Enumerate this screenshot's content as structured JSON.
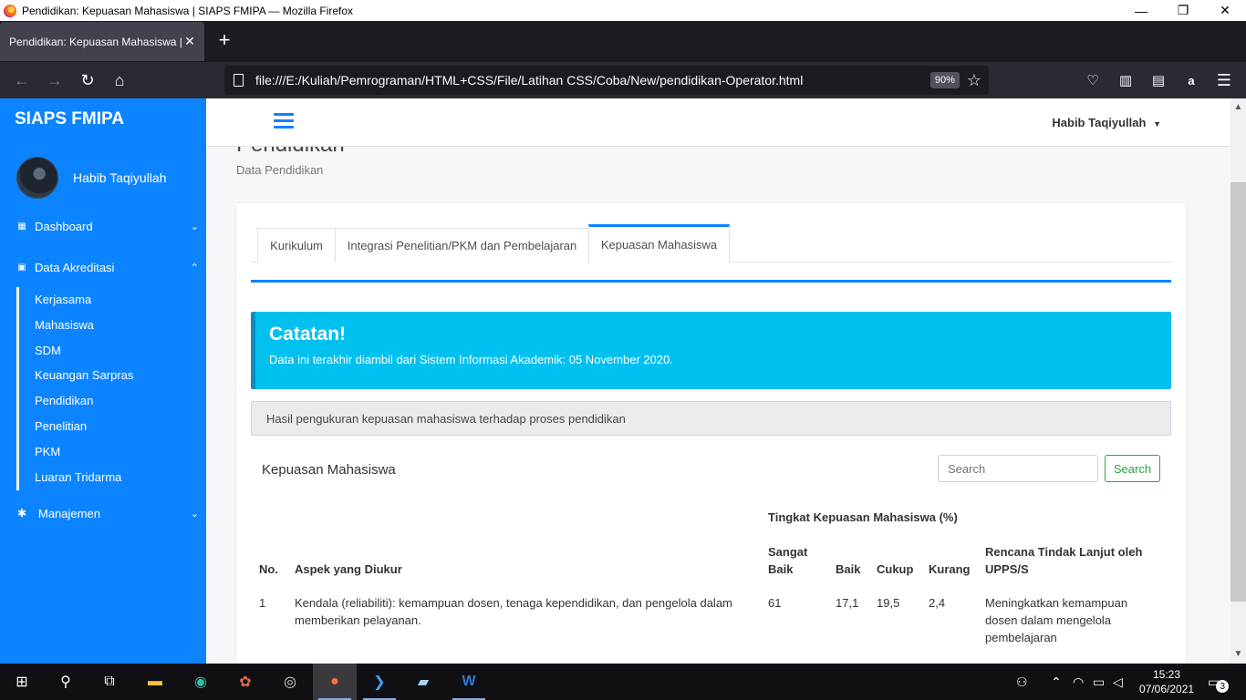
{
  "window": {
    "title": "Pendidikan: Kepuasan Mahasiswa | SIAPS FMIPA — Mozilla Firefox",
    "minimize": "—",
    "restore": "❐",
    "close": "✕"
  },
  "browser": {
    "tab_title": "Pendidikan: Kepuasan Mahasiswa | SIAPS FMIPA",
    "tab_close": "✕",
    "new_tab": "+",
    "url": "file:///E:/Kuliah/Pemrograman/HTML+CSS/File/Latihan CSS/Coba/New/pendidikan-Operator.html",
    "zoom": "90%"
  },
  "sidebar": {
    "brand": "SIAPS FMIPA",
    "user_name": "Habib Taqiyullah",
    "dashboard": "Dashboard",
    "data_akreditasi": "Data Akreditasi",
    "sub_items": [
      "Kerjasama",
      "Mahasiswa",
      "SDM",
      "Keuangan Sarpras",
      "Pendidikan",
      "Penelitian",
      "PKM",
      "Luaran Tridarma"
    ],
    "manajemen": "Manajemen"
  },
  "topnav": {
    "user": "Habib Taqiyullah"
  },
  "header": {
    "title": "Pendidikan",
    "subtitle": "Data Pendidikan"
  },
  "tabs": [
    "Kurikulum",
    "Integrasi Penelitian/PKM dan Pembelajaran",
    "Kepuasan Mahasiswa"
  ],
  "callout": {
    "title": "Catatan!",
    "text": "Data ini terakhir diambil dari Sistem Informasi Akademik: 05 November 2020."
  },
  "info_bar": "Hasil pengukuran kepuasan mahasiswa terhadap proses pendidikan",
  "table": {
    "title": "Kepuasan Mahasiswa",
    "search_placeholder": "Search",
    "search_button": "Search",
    "group_header": "Tingkat Kepuasan Mahasiswa (%)",
    "columns": {
      "no": "No.",
      "aspek": "Aspek yang Diukur",
      "sangat_baik_1": "Sangat",
      "sangat_baik_2": "Baik",
      "baik": "Baik",
      "cukup": "Cukup",
      "kurang": "Kurang",
      "rencana_1": "Rencana Tindak Lanjut oleh",
      "rencana_2": "UPPS/S"
    },
    "rows": [
      {
        "no": "1",
        "aspek_1": "Kendala (reliabiliti): kemampuan dosen, tenaga kependidikan, dan pengelola dalam",
        "aspek_2": "memberikan pelayanan.",
        "sangat_baik": "61",
        "baik": "17,1",
        "cukup": "19,5",
        "kurang": "2,4",
        "rencana_1": "Meningkatkan kemampuan",
        "rencana_2": "dosen dalam mengelola",
        "rencana_3": "pembelajaran"
      }
    ]
  },
  "taskbar": {
    "time": "15:23",
    "date": "07/06/2021",
    "notifications": "3"
  }
}
